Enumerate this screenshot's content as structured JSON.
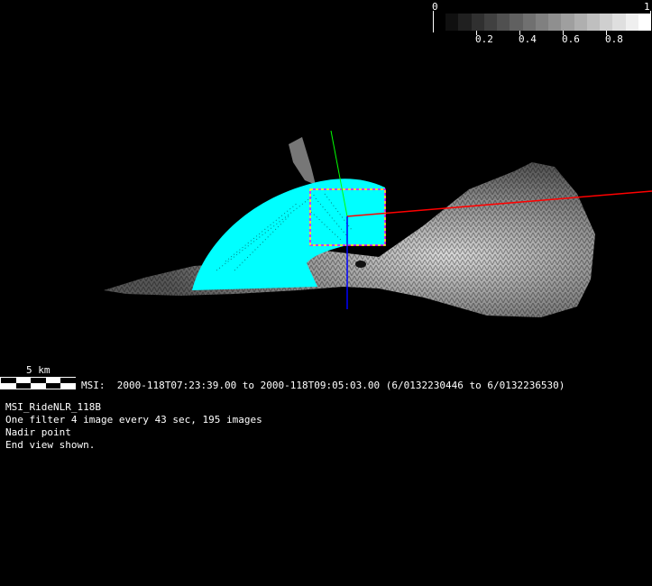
{
  "colorbar": {
    "min_label": "0",
    "max_label": "1",
    "tick_labels": [
      "0.2",
      "0.4",
      "0.6",
      "0.8"
    ],
    "segments": 16
  },
  "scale_bar": {
    "label": "5 km"
  },
  "header_line": "MSI:  2000-118T07:23:39.00 to 2000-118T09:05:03.00 (6/0132230446 to 6/0132236530)",
  "info_lines": [
    "MSI_RideNLR_118B",
    "One filter 4 image every 43 sec, 195 images",
    "Nadir point",
    "End view shown."
  ],
  "colors": {
    "footprint": "#00ffff",
    "x_axis": "#ff0000",
    "y_axis": "#00ff00",
    "z_axis": "#0000ff",
    "frame": "#ff00ff",
    "frame_dash": "#ffff00"
  }
}
